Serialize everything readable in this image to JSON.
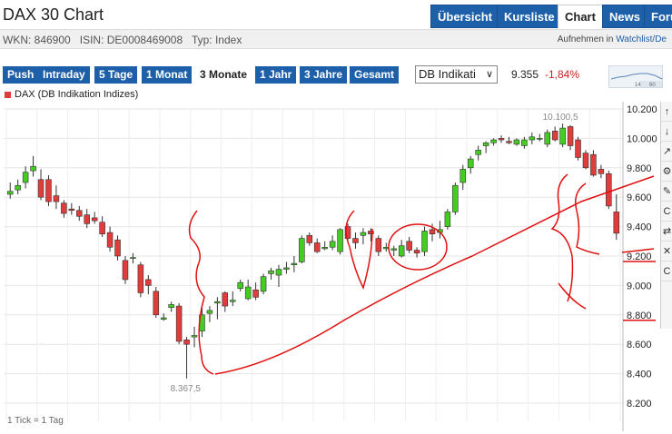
{
  "page": {
    "title": "DAX 30 Chart"
  },
  "nav": {
    "tabs": [
      {
        "label": "Übersicht",
        "active": false
      },
      {
        "label": "Kursliste",
        "active": false
      },
      {
        "label": "Chart",
        "active": true
      },
      {
        "label": "News",
        "active": false
      },
      {
        "label": "Foru",
        "active": false
      }
    ]
  },
  "meta": {
    "wkn": "WKN: 846900",
    "isin": "ISIN: DE0008469008",
    "typ": "Typ: Index",
    "watch_prefix": "Aufnehmen in",
    "watch_link": "Watchlist/De"
  },
  "ranges": [
    {
      "label": "Push",
      "active": false
    },
    {
      "label": "Intraday",
      "active": false
    },
    {
      "label": "5 Tage",
      "active": false
    },
    {
      "label": "1 Monat",
      "active": false
    },
    {
      "label": "3 Monate",
      "active": true
    },
    {
      "label": "1 Jahr",
      "active": false
    },
    {
      "label": "3 Jahre",
      "active": false
    },
    {
      "label": "Gesamt",
      "active": false
    }
  ],
  "exchange_select": {
    "value": "DB Indikati"
  },
  "quote": {
    "price": "9.355",
    "change": "-1,84%"
  },
  "mini_chart": {
    "labels": [
      "14",
      "60"
    ]
  },
  "legend": {
    "label": "DAX (DB Indikation Indizes)"
  },
  "footnote": "1 Tick = 1 Tag",
  "side_tools": [
    "↑",
    "↓",
    "↗",
    "⚙",
    "✎",
    "C",
    "⇄",
    "✕",
    "C"
  ],
  "chart_data": {
    "type": "candlestick",
    "y_axis": {
      "min": 8200,
      "max": 10200,
      "ticks": [
        "10.200",
        "10.000",
        "9.800",
        "9.600",
        "9.400",
        "9.200",
        "9.000",
        "8.800",
        "8.600",
        "8.400",
        "8.200"
      ]
    },
    "annotations": [
      {
        "label": "10.100,5",
        "type": "high"
      },
      {
        "label": "8.367,5",
        "type": "low"
      }
    ],
    "highlighted_ticks": [
      "9.200",
      "8.800"
    ],
    "candles": [
      {
        "o": 9620,
        "h": 9700,
        "l": 9590,
        "c": 9640
      },
      {
        "o": 9650,
        "h": 9720,
        "l": 9620,
        "c": 9680
      },
      {
        "o": 9700,
        "h": 9810,
        "l": 9660,
        "c": 9770
      },
      {
        "o": 9780,
        "h": 9880,
        "l": 9740,
        "c": 9810
      },
      {
        "o": 9720,
        "h": 9790,
        "l": 9580,
        "c": 9600
      },
      {
        "o": 9720,
        "h": 9750,
        "l": 9540,
        "c": 9570
      },
      {
        "o": 9610,
        "h": 9680,
        "l": 9520,
        "c": 9570
      },
      {
        "o": 9560,
        "h": 9580,
        "l": 9460,
        "c": 9490
      },
      {
        "o": 9520,
        "h": 9560,
        "l": 9480,
        "c": 9510
      },
      {
        "o": 9510,
        "h": 9540,
        "l": 9440,
        "c": 9470
      },
      {
        "o": 9480,
        "h": 9520,
        "l": 9390,
        "c": 9420
      },
      {
        "o": 9460,
        "h": 9500,
        "l": 9420,
        "c": 9440
      },
      {
        "o": 9430,
        "h": 9470,
        "l": 9330,
        "c": 9350
      },
      {
        "o": 9360,
        "h": 9400,
        "l": 9230,
        "c": 9260
      },
      {
        "o": 9310,
        "h": 9340,
        "l": 9170,
        "c": 9200
      },
      {
        "o": 9170,
        "h": 9200,
        "l": 9010,
        "c": 9040
      },
      {
        "o": 9190,
        "h": 9220,
        "l": 9150,
        "c": 9190
      },
      {
        "o": 9140,
        "h": 9160,
        "l": 8920,
        "c": 8950
      },
      {
        "o": 9040,
        "h": 9070,
        "l": 8940,
        "c": 9000
      },
      {
        "o": 8960,
        "h": 8990,
        "l": 8780,
        "c": 8800
      },
      {
        "o": 8770,
        "h": 8810,
        "l": 8760,
        "c": 8780
      },
      {
        "o": 8850,
        "h": 8890,
        "l": 8820,
        "c": 8870
      },
      {
        "o": 8860,
        "h": 8880,
        "l": 8600,
        "c": 8620
      },
      {
        "o": 8630,
        "h": 8650,
        "l": 8367.5,
        "c": 8600
      },
      {
        "o": 8650,
        "h": 8720,
        "l": 8580,
        "c": 8660
      },
      {
        "o": 8690,
        "h": 8860,
        "l": 8650,
        "c": 8800
      },
      {
        "o": 8810,
        "h": 8860,
        "l": 8750,
        "c": 8830
      },
      {
        "o": 8880,
        "h": 8920,
        "l": 8770,
        "c": 8890
      },
      {
        "o": 8950,
        "h": 8960,
        "l": 8820,
        "c": 8860
      },
      {
        "o": 8890,
        "h": 8960,
        "l": 8860,
        "c": 8900
      },
      {
        "o": 8980,
        "h": 9040,
        "l": 8960,
        "c": 9020
      },
      {
        "o": 8910,
        "h": 9040,
        "l": 8900,
        "c": 8990
      },
      {
        "o": 8970,
        "h": 9020,
        "l": 8900,
        "c": 8920
      },
      {
        "o": 8960,
        "h": 9080,
        "l": 8940,
        "c": 9060
      },
      {
        "o": 9080,
        "h": 9120,
        "l": 9040,
        "c": 9100
      },
      {
        "o": 9070,
        "h": 9140,
        "l": 8990,
        "c": 9110
      },
      {
        "o": 9110,
        "h": 9160,
        "l": 9080,
        "c": 9120
      },
      {
        "o": 9140,
        "h": 9200,
        "l": 9090,
        "c": 9150
      },
      {
        "o": 9160,
        "h": 9340,
        "l": 9150,
        "c": 9320
      },
      {
        "o": 9340,
        "h": 9360,
        "l": 9270,
        "c": 9290
      },
      {
        "o": 9290,
        "h": 9320,
        "l": 9220,
        "c": 9230
      },
      {
        "o": 9250,
        "h": 9300,
        "l": 9240,
        "c": 9260
      },
      {
        "o": 9260,
        "h": 9340,
        "l": 9240,
        "c": 9300
      },
      {
        "o": 9230,
        "h": 9390,
        "l": 9210,
        "c": 9380
      },
      {
        "o": 9400,
        "h": 9420,
        "l": 9300,
        "c": 9320
      },
      {
        "o": 9320,
        "h": 9360,
        "l": 9250,
        "c": 9290
      },
      {
        "o": 9340,
        "h": 9390,
        "l": 9280,
        "c": 9360
      },
      {
        "o": 9370,
        "h": 9390,
        "l": 9300,
        "c": 9350
      },
      {
        "o": 9320,
        "h": 9340,
        "l": 9200,
        "c": 9230
      },
      {
        "o": 9250,
        "h": 9290,
        "l": 9230,
        "c": 9260
      },
      {
        "o": 9240,
        "h": 9270,
        "l": 9200,
        "c": 9250
      },
      {
        "o": 9200,
        "h": 9310,
        "l": 9190,
        "c": 9270
      },
      {
        "o": 9300,
        "h": 9330,
        "l": 9220,
        "c": 9240
      },
      {
        "o": 9240,
        "h": 9260,
        "l": 9190,
        "c": 9220
      },
      {
        "o": 9230,
        "h": 9400,
        "l": 9200,
        "c": 9370
      },
      {
        "o": 9380,
        "h": 9420,
        "l": 9300,
        "c": 9350
      },
      {
        "o": 9360,
        "h": 9440,
        "l": 9320,
        "c": 9380
      },
      {
        "o": 9400,
        "h": 9520,
        "l": 9380,
        "c": 9500
      },
      {
        "o": 9500,
        "h": 9700,
        "l": 9480,
        "c": 9680
      },
      {
        "o": 9700,
        "h": 9820,
        "l": 9650,
        "c": 9790
      },
      {
        "o": 9800,
        "h": 9880,
        "l": 9760,
        "c": 9860
      },
      {
        "o": 9890,
        "h": 9950,
        "l": 9850,
        "c": 9920
      },
      {
        "o": 9950,
        "h": 9980,
        "l": 9900,
        "c": 9970
      },
      {
        "o": 9970,
        "h": 10000,
        "l": 9950,
        "c": 9990
      },
      {
        "o": 10000,
        "h": 10020,
        "l": 9970,
        "c": 9990
      },
      {
        "o": 9980,
        "h": 10010,
        "l": 9960,
        "c": 9970
      },
      {
        "o": 9960,
        "h": 10000,
        "l": 9950,
        "c": 9990
      },
      {
        "o": 9950,
        "h": 10010,
        "l": 9930,
        "c": 9990
      },
      {
        "o": 9990,
        "h": 10040,
        "l": 9960,
        "c": 10010
      },
      {
        "o": 10000,
        "h": 10030,
        "l": 9980,
        "c": 10000
      },
      {
        "o": 9960,
        "h": 10060,
        "l": 9940,
        "c": 10040
      },
      {
        "o": 10050,
        "h": 10080,
        "l": 9980,
        "c": 9990
      },
      {
        "o": 9960,
        "h": 10100.5,
        "l": 9940,
        "c": 10070
      },
      {
        "o": 10080,
        "h": 10090,
        "l": 9920,
        "c": 9950
      },
      {
        "o": 9990,
        "h": 10010,
        "l": 9850,
        "c": 9870
      },
      {
        "o": 9900,
        "h": 9920,
        "l": 9790,
        "c": 9800
      },
      {
        "o": 9890,
        "h": 9920,
        "l": 9740,
        "c": 9750
      },
      {
        "o": 9790,
        "h": 9820,
        "l": 9730,
        "c": 9760
      },
      {
        "o": 9760,
        "h": 9780,
        "l": 9520,
        "c": 9540
      },
      {
        "o": 9500,
        "h": 9620,
        "l": 9310,
        "c": 9355
      }
    ]
  },
  "colors": {
    "nav_blue": "#1d5fa8",
    "candle_up": "#44cc22",
    "candle_down": "#e03c3c",
    "annotation_red": "#e01010"
  }
}
